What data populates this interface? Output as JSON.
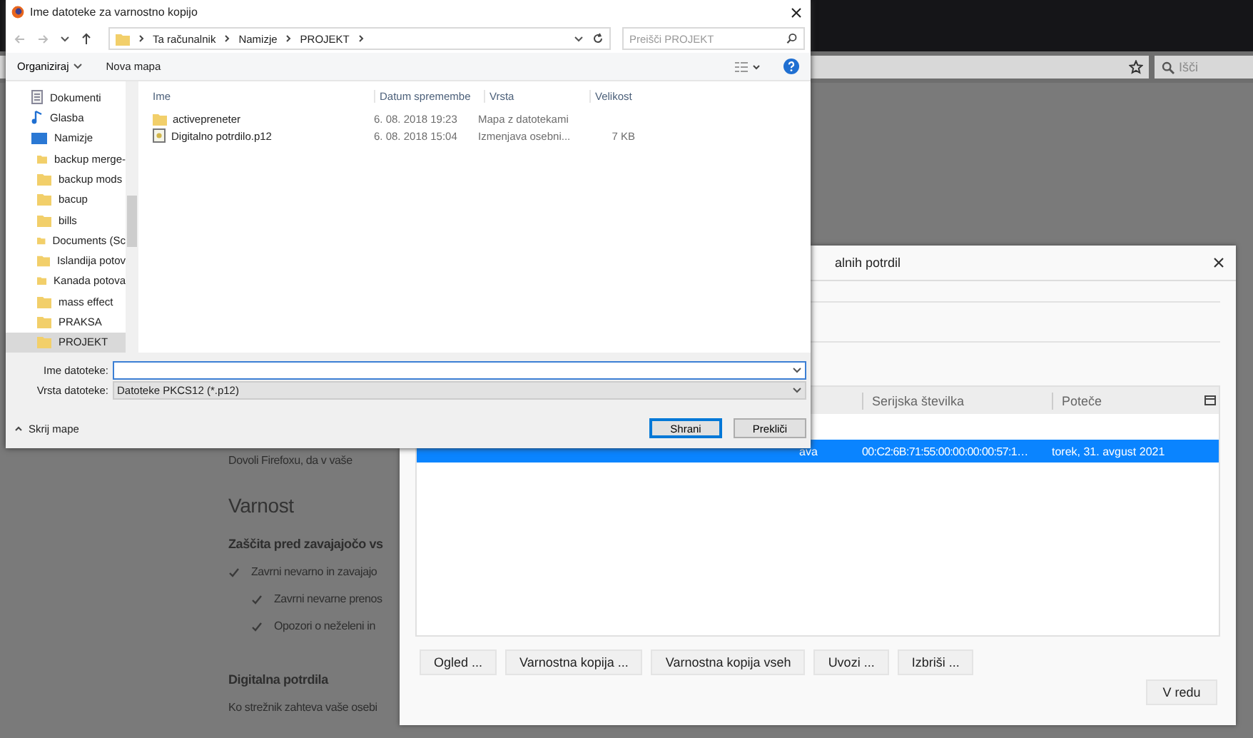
{
  "browser": {
    "search": {
      "placeholder": "Išči"
    }
  },
  "page": {
    "intro": "Dovoli Firefoxu, da v vaše",
    "section_title": "Varnost",
    "subsection": "Zaščita pred zavajajočo vs",
    "options": [
      {
        "label": "Zavrni nevarno in zavajajo",
        "checked": true,
        "children": [
          {
            "label": "Zavrni nevarne prenos",
            "checked": true
          },
          {
            "label": "Opozori o neželeni in",
            "checked": true
          }
        ]
      }
    ],
    "certs_title": "Digitalna potrdila",
    "certs_text": "Ko strežnik zahteva vaše osebi"
  },
  "cert_manager": {
    "title": "alnih potrdil",
    "columns": [
      "",
      "Serijska številka",
      "Poteče"
    ],
    "rows": [
      {
        "cells": [
          "ava",
          "00:C2:6B:71:55:00:00:00:00:57:1…",
          "torek, 31. avgust 2021"
        ],
        "selected": true
      }
    ],
    "buttons": [
      "Ogled ...",
      "Varnostna kopija ...",
      "Varnostna kopija vseh",
      "Uvozi ...",
      "Izbriši ..."
    ],
    "ok_button": "V redu"
  },
  "file_dialog": {
    "title": "Ime datoteke za varnostno kopijo",
    "address": [
      "Ta računalnik",
      "Namizje",
      "PROJEKT"
    ],
    "search": {
      "placeholder": "Preišči PROJEKT"
    },
    "toolbar": {
      "organize": "Organiziraj",
      "new_folder": "Nova mapa"
    },
    "nav": [
      {
        "label": "Dokumenti",
        "kind": "documents",
        "selected": false
      },
      {
        "label": "Glasba",
        "kind": "music",
        "selected": false
      },
      {
        "label": "Namizje",
        "kind": "desktop",
        "selected": false,
        "children": [
          {
            "label": "backup merge-",
            "kind": "folder",
            "selected": false
          },
          {
            "label": "backup mods",
            "kind": "folder",
            "selected": false
          },
          {
            "label": "bacup",
            "kind": "folder",
            "selected": false
          },
          {
            "label": "bills",
            "kind": "folder",
            "selected": false
          },
          {
            "label": "Documents (Sc",
            "kind": "folder",
            "selected": false
          },
          {
            "label": "Islandija potov",
            "kind": "folder",
            "selected": false
          },
          {
            "label": "Kanada potova",
            "kind": "folder",
            "selected": false
          },
          {
            "label": "mass effect",
            "kind": "folder",
            "selected": false
          },
          {
            "label": "PRAKSA",
            "kind": "folder",
            "selected": false
          },
          {
            "label": "PROJEKT",
            "kind": "folder",
            "selected": true
          }
        ]
      }
    ],
    "columns": [
      "Ime",
      "Datum spremembe",
      "Vrsta",
      "Velikost"
    ],
    "files": [
      {
        "name": "activepreneter",
        "date": "6. 08. 2018 19:23",
        "type": "Mapa z datotekami",
        "kind": "folder"
      },
      {
        "name": "Digitalno potrdilo.p12",
        "date": "6. 08. 2018 15:04",
        "type": "Izmenjava osebni...",
        "size": "7 KB",
        "kind": "certificate"
      }
    ],
    "filename": {
      "label": "Ime datoteke:"
    },
    "filetype": {
      "label": "Vrsta datoteke:",
      "value": "Datoteke PKCS12 (*.p12)"
    },
    "hide_folders": "Skrij mape",
    "buttons": [
      {
        "label": "Shrani",
        "default": true
      },
      {
        "label": "Prekliči",
        "default": false
      }
    ]
  }
}
